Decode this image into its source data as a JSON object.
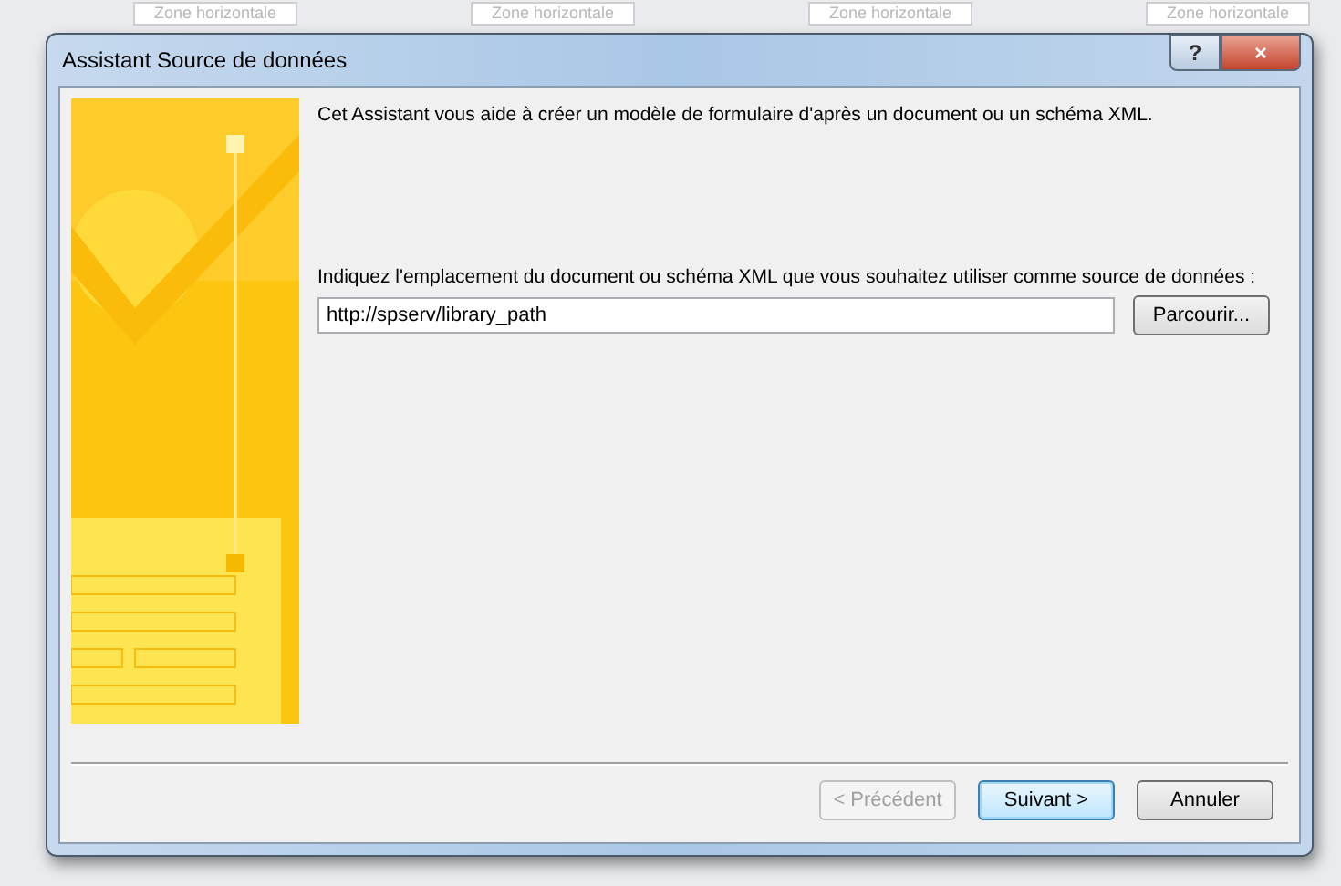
{
  "background_labels": [
    "Zone horizontale",
    "Zone horizontale",
    "Zone horizontale",
    "Zone horizontale"
  ],
  "window": {
    "title": "Assistant Source de données",
    "help_button": "?",
    "close_button": "×"
  },
  "intro": "Cet Assistant vous aide à créer un modèle de formulaire d'après un document ou un schéma XML.",
  "location": {
    "label": "Indiquez l'emplacement du document ou schéma XML que vous souhaitez utiliser comme source de données :",
    "value": "http://spserv/library_path",
    "browse_button": "Parcourir..."
  },
  "buttons": [
    {
      "label": "< Précédent",
      "disabled": true,
      "default": false
    },
    {
      "label": "Suivant >",
      "disabled": false,
      "default": true
    },
    {
      "label": "Annuler",
      "disabled": false,
      "default": false
    }
  ]
}
